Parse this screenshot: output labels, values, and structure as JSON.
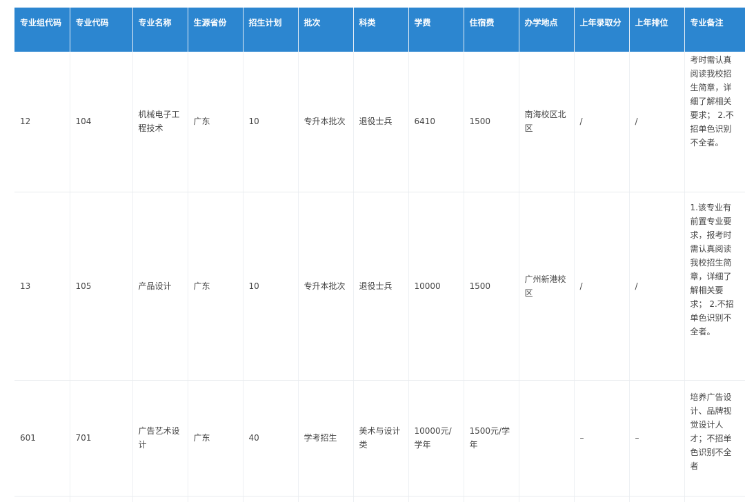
{
  "table": {
    "headers": [
      "专业组代码",
      "专业代码",
      "专业名称",
      "生源省份",
      "招生计划",
      "批次",
      "科类",
      "学费",
      "住宿费",
      "办学地点",
      "上年录取分",
      "上年排位",
      "专业备注"
    ],
    "rows": [
      [
        "12",
        "104",
        "机械电子工程技术",
        "广东",
        "10",
        "专升本批次",
        "退役士兵",
        "6410",
        "1500",
        "南海校区北区",
        "/",
        "/",
        "考时需认真阅读我校招生简章，详细了解相关要求； 2.不招单色识别不全者。"
      ],
      [
        "13",
        "105",
        "产品设计",
        "广东",
        "10",
        "专升本批次",
        "退役士兵",
        "10000",
        "1500",
        "广州新港校区",
        "/",
        "/",
        "1.该专业有前置专业要求，报考时需认真阅读我校招生简章，详细了解相关要求； 2.不招单色识别不全者。"
      ],
      [
        "601",
        "701",
        "广告艺术设计",
        "广东",
        "40",
        "学考招生",
        "美术与设计类",
        "10000元/学年",
        "1500元/学年",
        "",
        "–",
        "–",
        "培养广告设计、品牌视觉设计人才；不招单色识别不全者"
      ],
      [
        "",
        "",
        "",
        "",
        "",
        "",
        "",
        "",
        "",
        "",
        "",
        "",
        ""
      ]
    ]
  }
}
